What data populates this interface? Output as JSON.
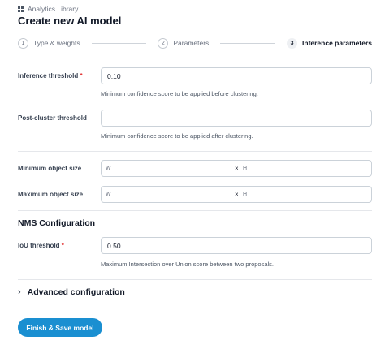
{
  "breadcrumb": {
    "label": "Analytics Library",
    "icon": "grid-icon"
  },
  "page": {
    "title": "Create new AI model"
  },
  "stepper": [
    {
      "num": "1",
      "label": "Type & weights",
      "active": false
    },
    {
      "num": "2",
      "label": "Parameters",
      "active": false
    },
    {
      "num": "3",
      "label": "Inference parameters",
      "active": true
    }
  ],
  "form": {
    "inference_threshold": {
      "label": "Inference threshold",
      "required": "*",
      "value": "0.10",
      "hint": "Minimum confidence score to be applied before clustering."
    },
    "post_cluster_threshold": {
      "label": "Post-cluster threshold",
      "value": "",
      "hint": "Minimum confidence score to be applied after clustering."
    },
    "min_object_size": {
      "label": "Minimum object size",
      "w": "W",
      "x": "×",
      "h": "H"
    },
    "max_object_size": {
      "label": "Maximum object size",
      "w": "W",
      "x": "×",
      "h": "H"
    }
  },
  "nms": {
    "title": "NMS Configuration",
    "iou_threshold": {
      "label": "IoU threshold",
      "required": "*",
      "value": "0.50",
      "hint": "Maximum Intersection over Union score between two proposals."
    }
  },
  "advanced": {
    "label": "Advanced configuration",
    "icon": "chevron-right-icon"
  },
  "actions": {
    "finish_label": "Finish & Save model",
    "accent": "#1a8fd1"
  }
}
